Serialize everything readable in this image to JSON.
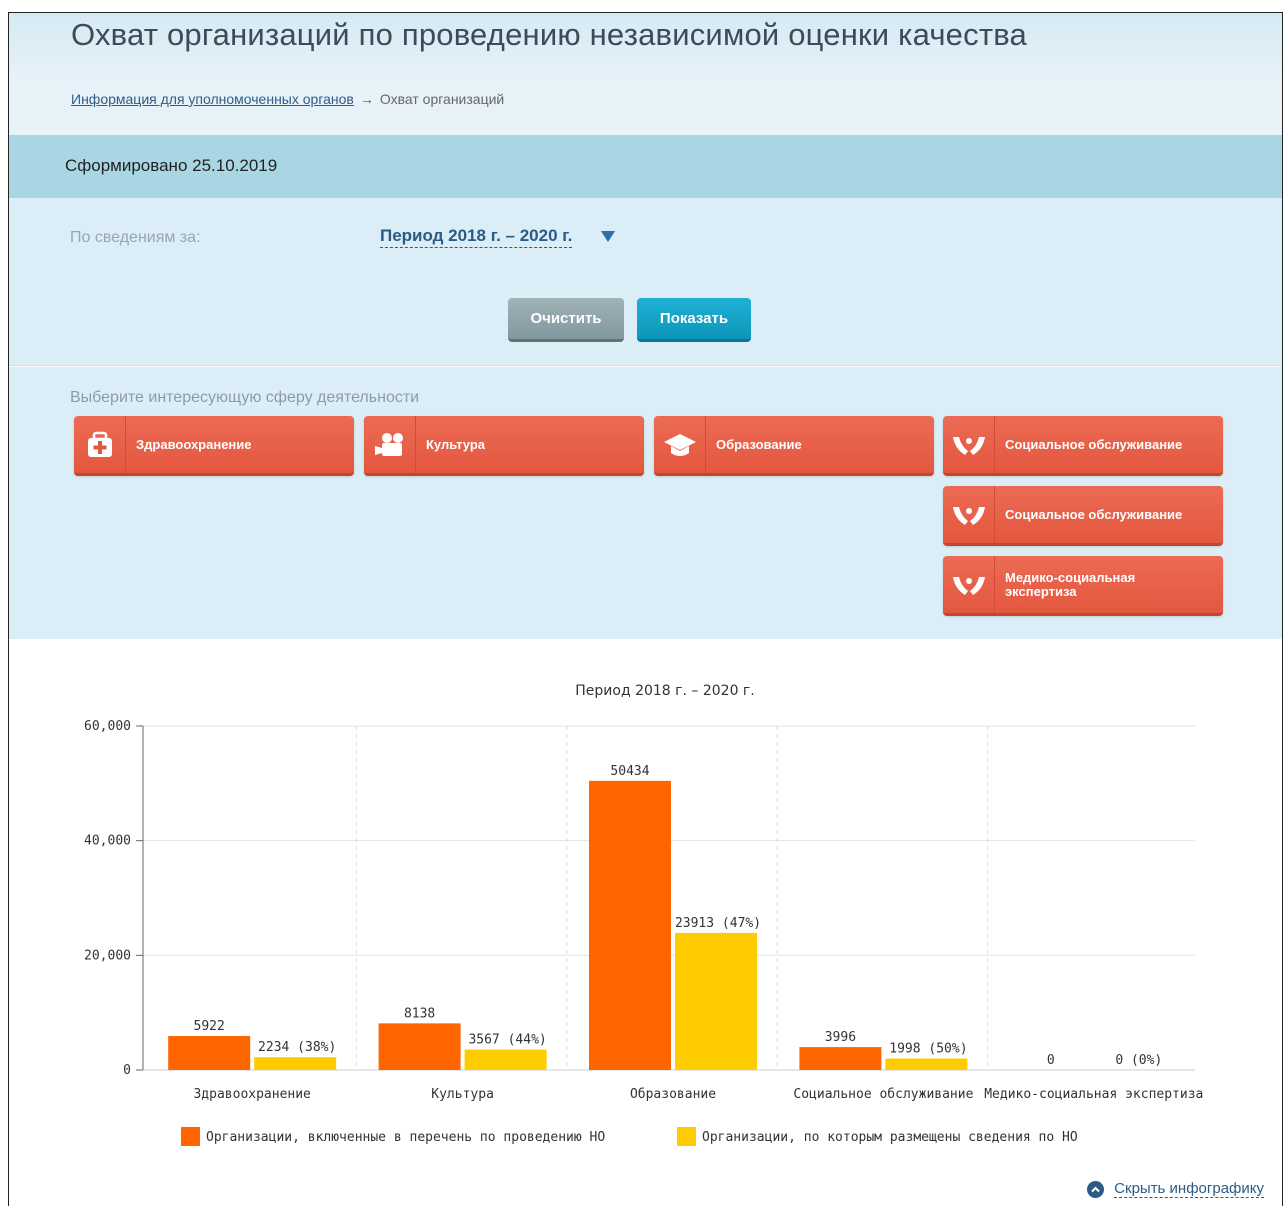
{
  "header": {
    "title": "Охват организаций по проведению независимой оценки качества",
    "breadcrumb": {
      "parent": "Информация для уполномоченных органов",
      "separator": "→",
      "current": "Охват организаций"
    }
  },
  "formed": {
    "text": "Сформировано 25.10.2019"
  },
  "filter": {
    "label": "По сведениям за:",
    "period_value": "Период 2018 г. – 2020 г.",
    "clear_label": "Очистить",
    "show_label": "Показать"
  },
  "spheres": {
    "label": "Выберите интересующую сферу деятельности",
    "items": [
      {
        "label": "Здравоохранение",
        "icon": "medkit-icon"
      },
      {
        "label": "Культура",
        "icon": "film-camera-icon"
      },
      {
        "label": "Образование",
        "icon": "graduation-cap-icon"
      },
      {
        "label": "Социальное обслуживание",
        "icon": "hands-icon"
      },
      {
        "label": "Социальное обслуживание",
        "icon": "hands-icon"
      },
      {
        "label": "Медико-социальная экспертиза",
        "icon": "hands-icon"
      }
    ]
  },
  "chart_data": {
    "type": "bar",
    "title": "Период 2018 г. – 2020 г.",
    "categories": [
      "Здравоохранение",
      "Культура",
      "Образование",
      "Социальное обслуживание",
      "Медико-социальная экспертиза"
    ],
    "series": [
      {
        "name": "Организации, включенные в перечень по проведению НО",
        "color": "#ff6600",
        "values": [
          5922,
          8138,
          50434,
          3996,
          0
        ],
        "labels": [
          "5922",
          "8138",
          "50434",
          "3996",
          "0"
        ]
      },
      {
        "name": "Организации, по которым размещены сведения по НО",
        "color": "#ffcc00",
        "values": [
          2234,
          3567,
          23913,
          1998,
          0
        ],
        "labels": [
          "2234 (38%)",
          "3567 (44%)",
          "23913 (47%)",
          "1998 (50%)",
          "0 (0%)"
        ]
      }
    ],
    "ylim": [
      0,
      60000
    ],
    "yticks": [
      0,
      20000,
      40000,
      60000
    ],
    "ytick_labels": [
      "0",
      "20,000",
      "40,000",
      "60,000"
    ],
    "grid": true,
    "legend_position": "bottom"
  },
  "footer": {
    "hide_label": "Скрыть инфографику"
  },
  "colors": {
    "sphere_button": "#e8604a",
    "show_button": "#13a3c6",
    "clear_button": "#8fa4aa",
    "formed_bar": "#a9d6e3",
    "panel": "#dbeef7",
    "link": "#2b5b87"
  }
}
